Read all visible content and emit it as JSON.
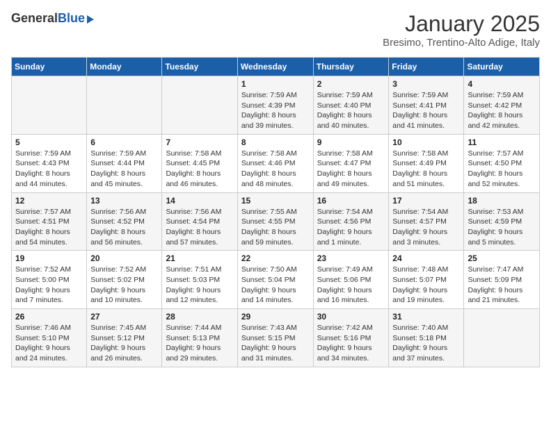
{
  "header": {
    "logo_general": "General",
    "logo_blue": "Blue",
    "month_title": "January 2025",
    "location": "Bresimo, Trentino-Alto Adige, Italy"
  },
  "days_of_week": [
    "Sunday",
    "Monday",
    "Tuesday",
    "Wednesday",
    "Thursday",
    "Friday",
    "Saturday"
  ],
  "weeks": [
    [
      {
        "day": "",
        "info": ""
      },
      {
        "day": "",
        "info": ""
      },
      {
        "day": "",
        "info": ""
      },
      {
        "day": "1",
        "info": "Sunrise: 7:59 AM\nSunset: 4:39 PM\nDaylight: 8 hours and 39 minutes."
      },
      {
        "day": "2",
        "info": "Sunrise: 7:59 AM\nSunset: 4:40 PM\nDaylight: 8 hours and 40 minutes."
      },
      {
        "day": "3",
        "info": "Sunrise: 7:59 AM\nSunset: 4:41 PM\nDaylight: 8 hours and 41 minutes."
      },
      {
        "day": "4",
        "info": "Sunrise: 7:59 AM\nSunset: 4:42 PM\nDaylight: 8 hours and 42 minutes."
      }
    ],
    [
      {
        "day": "5",
        "info": "Sunrise: 7:59 AM\nSunset: 4:43 PM\nDaylight: 8 hours and 44 minutes."
      },
      {
        "day": "6",
        "info": "Sunrise: 7:59 AM\nSunset: 4:44 PM\nDaylight: 8 hours and 45 minutes."
      },
      {
        "day": "7",
        "info": "Sunrise: 7:58 AM\nSunset: 4:45 PM\nDaylight: 8 hours and 46 minutes."
      },
      {
        "day": "8",
        "info": "Sunrise: 7:58 AM\nSunset: 4:46 PM\nDaylight: 8 hours and 48 minutes."
      },
      {
        "day": "9",
        "info": "Sunrise: 7:58 AM\nSunset: 4:47 PM\nDaylight: 8 hours and 49 minutes."
      },
      {
        "day": "10",
        "info": "Sunrise: 7:58 AM\nSunset: 4:49 PM\nDaylight: 8 hours and 51 minutes."
      },
      {
        "day": "11",
        "info": "Sunrise: 7:57 AM\nSunset: 4:50 PM\nDaylight: 8 hours and 52 minutes."
      }
    ],
    [
      {
        "day": "12",
        "info": "Sunrise: 7:57 AM\nSunset: 4:51 PM\nDaylight: 8 hours and 54 minutes."
      },
      {
        "day": "13",
        "info": "Sunrise: 7:56 AM\nSunset: 4:52 PM\nDaylight: 8 hours and 56 minutes."
      },
      {
        "day": "14",
        "info": "Sunrise: 7:56 AM\nSunset: 4:54 PM\nDaylight: 8 hours and 57 minutes."
      },
      {
        "day": "15",
        "info": "Sunrise: 7:55 AM\nSunset: 4:55 PM\nDaylight: 8 hours and 59 minutes."
      },
      {
        "day": "16",
        "info": "Sunrise: 7:54 AM\nSunset: 4:56 PM\nDaylight: 9 hours and 1 minute."
      },
      {
        "day": "17",
        "info": "Sunrise: 7:54 AM\nSunset: 4:57 PM\nDaylight: 9 hours and 3 minutes."
      },
      {
        "day": "18",
        "info": "Sunrise: 7:53 AM\nSunset: 4:59 PM\nDaylight: 9 hours and 5 minutes."
      }
    ],
    [
      {
        "day": "19",
        "info": "Sunrise: 7:52 AM\nSunset: 5:00 PM\nDaylight: 9 hours and 7 minutes."
      },
      {
        "day": "20",
        "info": "Sunrise: 7:52 AM\nSunset: 5:02 PM\nDaylight: 9 hours and 10 minutes."
      },
      {
        "day": "21",
        "info": "Sunrise: 7:51 AM\nSunset: 5:03 PM\nDaylight: 9 hours and 12 minutes."
      },
      {
        "day": "22",
        "info": "Sunrise: 7:50 AM\nSunset: 5:04 PM\nDaylight: 9 hours and 14 minutes."
      },
      {
        "day": "23",
        "info": "Sunrise: 7:49 AM\nSunset: 5:06 PM\nDaylight: 9 hours and 16 minutes."
      },
      {
        "day": "24",
        "info": "Sunrise: 7:48 AM\nSunset: 5:07 PM\nDaylight: 9 hours and 19 minutes."
      },
      {
        "day": "25",
        "info": "Sunrise: 7:47 AM\nSunset: 5:09 PM\nDaylight: 9 hours and 21 minutes."
      }
    ],
    [
      {
        "day": "26",
        "info": "Sunrise: 7:46 AM\nSunset: 5:10 PM\nDaylight: 9 hours and 24 minutes."
      },
      {
        "day": "27",
        "info": "Sunrise: 7:45 AM\nSunset: 5:12 PM\nDaylight: 9 hours and 26 minutes."
      },
      {
        "day": "28",
        "info": "Sunrise: 7:44 AM\nSunset: 5:13 PM\nDaylight: 9 hours and 29 minutes."
      },
      {
        "day": "29",
        "info": "Sunrise: 7:43 AM\nSunset: 5:15 PM\nDaylight: 9 hours and 31 minutes."
      },
      {
        "day": "30",
        "info": "Sunrise: 7:42 AM\nSunset: 5:16 PM\nDaylight: 9 hours and 34 minutes."
      },
      {
        "day": "31",
        "info": "Sunrise: 7:40 AM\nSunset: 5:18 PM\nDaylight: 9 hours and 37 minutes."
      },
      {
        "day": "",
        "info": ""
      }
    ]
  ]
}
